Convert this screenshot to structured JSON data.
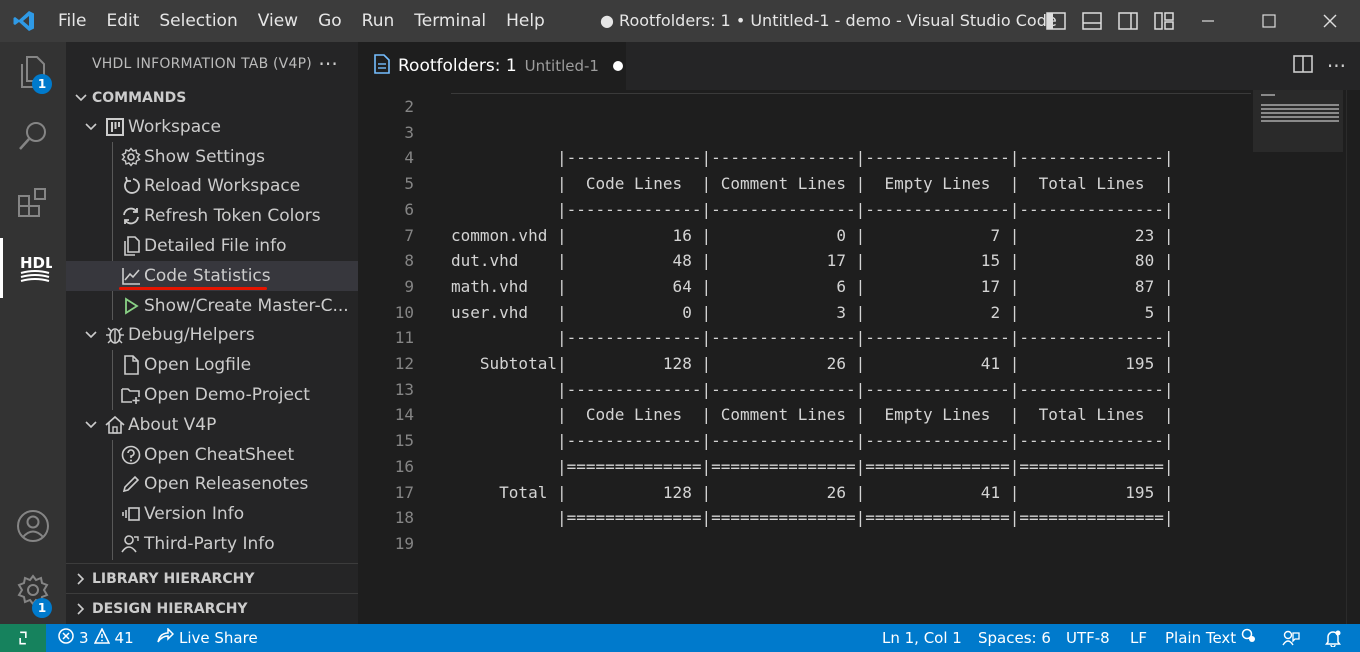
{
  "window": {
    "title": "● Rootfolders: 1 • Untitled-1 - demo - Visual Studio Code",
    "menu": [
      "File",
      "Edit",
      "Selection",
      "View",
      "Go",
      "Run",
      "Terminal",
      "Help"
    ]
  },
  "activity": {
    "explorer_badge": "1",
    "settings_badge": "1"
  },
  "sidebar": {
    "header": "VHDL INFORMATION TAB (V4P)",
    "more": "···",
    "commands_title": "COMMANDS",
    "workspace": "Workspace",
    "items_workspace": [
      "Show Settings",
      "Reload Workspace",
      "Refresh Token Colors",
      "Detailed File info",
      "Code Statistics",
      "Show/Create Master-C..."
    ],
    "debug": "Debug/Helpers",
    "items_debug": [
      "Open Logfile",
      "Open Demo-Project"
    ],
    "about": "About V4P",
    "items_about": [
      "Open CheatSheet",
      "Open Releasenotes",
      "Version Info",
      "Third-Party Info"
    ],
    "library_hierarchy": "LIBRARY HIERARCHY",
    "design_hierarchy": "DESIGN HIERARCHY"
  },
  "editor": {
    "tab_name": "Rootfolders: 1",
    "tab_desc": "Untitled-1",
    "lines": [
      {
        "n": "2",
        "t": ""
      },
      {
        "n": "3",
        "t": ""
      },
      {
        "n": "4",
        "t": "           |--------------|---------------|---------------|---------------|"
      },
      {
        "n": "5",
        "t": "           |  Code Lines  | Comment Lines |  Empty Lines  |  Total Lines  |"
      },
      {
        "n": "6",
        "t": "           |--------------|---------------|---------------|---------------|"
      },
      {
        "n": "7",
        "t": "common.vhd |           16 |             0 |             7 |            23 |"
      },
      {
        "n": "8",
        "t": "dut.vhd    |           48 |            17 |            15 |            80 |"
      },
      {
        "n": "9",
        "t": "math.vhd   |           64 |             6 |            17 |            87 |"
      },
      {
        "n": "10",
        "t": "user.vhd   |            0 |             3 |             2 |             5 |"
      },
      {
        "n": "11",
        "t": "           |--------------|---------------|---------------|---------------|"
      },
      {
        "n": "12",
        "t": "   Subtotal|          128 |            26 |            41 |           195 |"
      },
      {
        "n": "13",
        "t": "           |--------------|---------------|---------------|---------------|"
      },
      {
        "n": "14",
        "t": "           |  Code Lines  | Comment Lines |  Empty Lines  |  Total Lines  |"
      },
      {
        "n": "15",
        "t": "           |--------------|---------------|---------------|---------------|"
      },
      {
        "n": "16",
        "t": "           |==============|===============|===============|===============|"
      },
      {
        "n": "17",
        "t": "     Total |          128 |            26 |            41 |           195 |"
      },
      {
        "n": "18",
        "t": "           |==============|===============|===============|===============|"
      },
      {
        "n": "19",
        "t": ""
      }
    ]
  },
  "status": {
    "errors": "3",
    "warnings": "41",
    "live_share": "Live Share",
    "position": "Ln 1, Col 1",
    "spaces": "Spaces: 6",
    "encoding": "UTF-8",
    "eol": "LF",
    "language": "Plain Text"
  },
  "colors": {
    "accent": "#007acc",
    "remote": "#16825d",
    "underline": "#e51400"
  }
}
